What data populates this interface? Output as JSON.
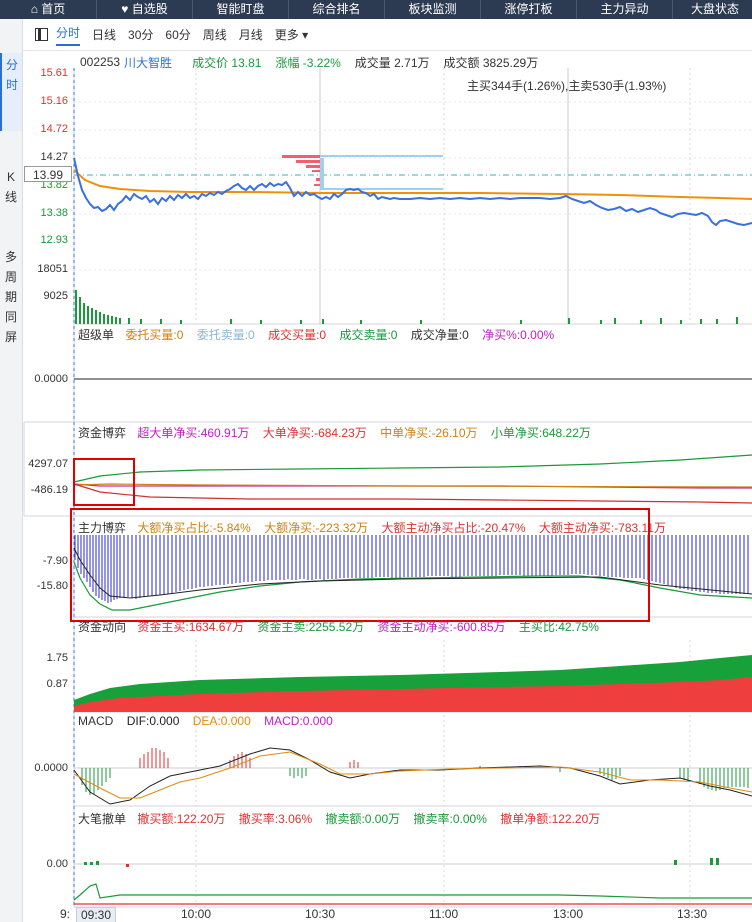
{
  "nav": {
    "items": [
      "首页",
      "自选股",
      "智能盯盘",
      "综合排名",
      "板块监测",
      "涨停打板",
      "主力异动",
      "大盘状态"
    ],
    "home_icon": "home-icon",
    "fav_icon": "heart-icon"
  },
  "sidebar": {
    "tabs": [
      "分时",
      "K线",
      "多周期同屏"
    ]
  },
  "toolbar": {
    "periods": [
      "分时",
      "日线",
      "30分",
      "60分",
      "周线",
      "月线"
    ],
    "more_label": "更多 ▾"
  },
  "stock": {
    "code": "002253",
    "name": "川大智胜",
    "price_label": "成交价 13.81",
    "change_label": "涨幅 -3.22%",
    "volume_label": "成交量 2.71万",
    "amount_label": "成交额 3825.29万",
    "buy_sell_label": "主买344手(1.26%),主卖530手(1.93%)"
  },
  "price_panel": {
    "y_labels": [
      "15.61",
      "15.16",
      "14.72",
      "14.27",
      "13.82",
      "13.38",
      "12.93"
    ],
    "current_price_tag": "13.99",
    "volume_labels": [
      "18051",
      "9025"
    ]
  },
  "panel_super": {
    "title": "超级单",
    "items": [
      "委托买量:0",
      "委托卖量:0",
      "成交买量:0",
      "成交卖量:0",
      "成交净量:0",
      "净买%:0.00%"
    ],
    "y_label": "0.0000"
  },
  "panel_fund": {
    "title": "资金博弈",
    "items": [
      "超大单净买:460.91万",
      "大单净买:-684.23万",
      "中单净买:-26.10万",
      "小单净买:648.22万"
    ],
    "y_labels": [
      "4297.07",
      "-486.19"
    ]
  },
  "panel_main": {
    "title": "主力博弈",
    "items": [
      "大额净买占比:-5.84%",
      "大额净买:-223.32万",
      "大额主动净买占比:-20.47%",
      "大额主动净买:-783.11万"
    ],
    "y_labels": [
      "-7.90",
      "-15.80"
    ]
  },
  "panel_flow": {
    "title": "资金动向",
    "items": [
      "资金主买:1634.67万",
      "资金主卖:2255.52万",
      "资金主动净买:-600.85万",
      "主买比:42.75%"
    ],
    "y_labels": [
      "1.75",
      "0.87"
    ]
  },
  "panel_macd": {
    "title": "MACD",
    "items": [
      "DIF:0.000",
      "DEA:0.000",
      "MACD:0.000"
    ],
    "y_label": "0.0000"
  },
  "panel_big": {
    "title": "大笔撤单",
    "items": [
      "撤买额:122.20万",
      "撤买率:3.06%",
      "撤卖额:0.00万",
      "撤卖率:0.00%",
      "撤单净额:122.20万"
    ],
    "y_label": "0.00"
  },
  "x_axis": {
    "labels": [
      "9:",
      "09:30",
      "10:00",
      "10:30",
      "11:00",
      "13:00",
      "13:30"
    ]
  },
  "colors": {
    "nav_bg": "#2c3a52",
    "accent": "#2c6fd3",
    "up": "#e03030",
    "down": "#1a9a3a",
    "price_line": "#3a6fe0",
    "avg_line": "#f0900a",
    "highlight": "#e00000"
  }
}
